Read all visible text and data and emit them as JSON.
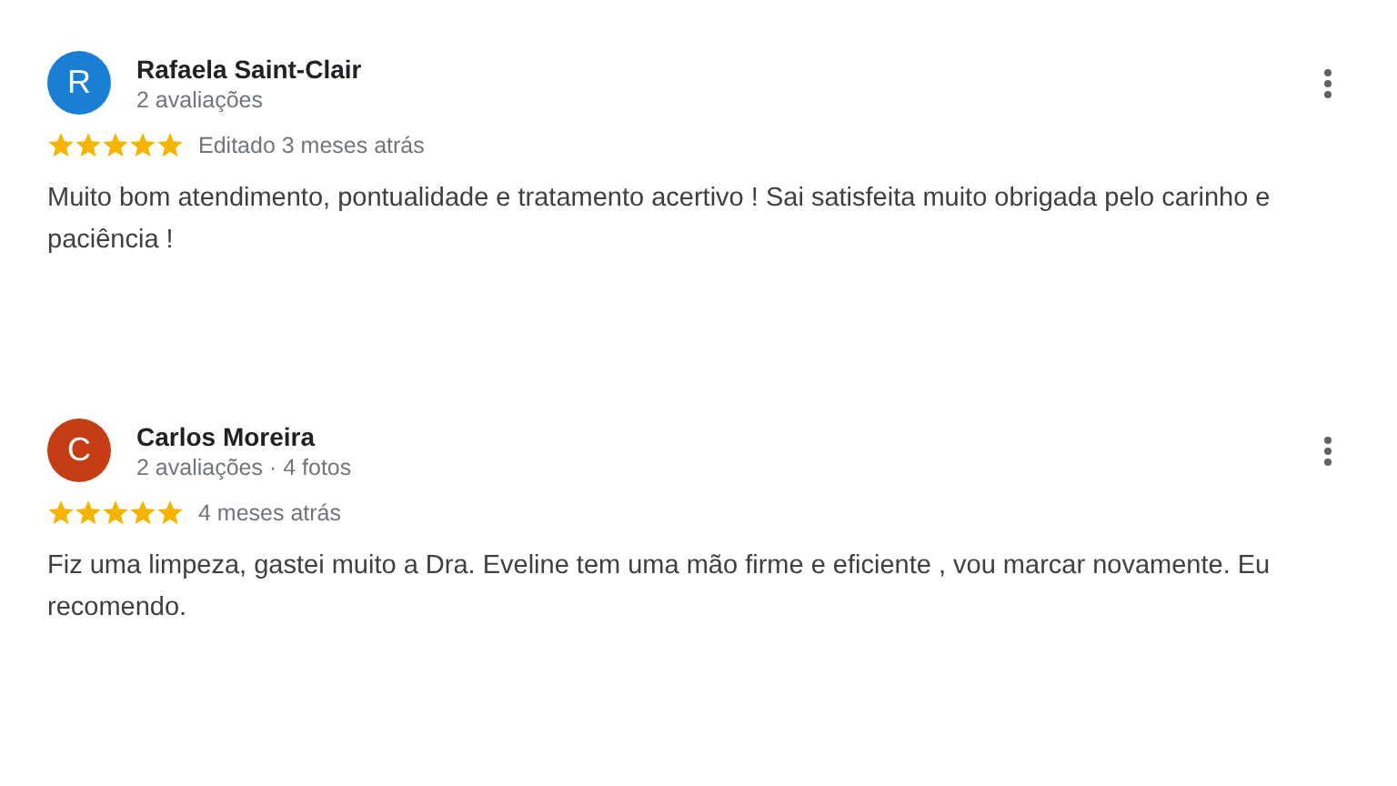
{
  "reviews": [
    {
      "avatar": "R",
      "color": "#1a7fd4",
      "name": "Rafaela Saint-Clair",
      "meta": "2 avaliações",
      "stars": 5,
      "time": "Editado 3 meses atrás",
      "text": "Muito bom atendimento, pontualidade e tratamento acertivo ! Sai satisfeita muito obrigada pelo carinho e paciência !"
    },
    {
      "avatar": "C",
      "color": "#c43d15",
      "name": "Carlos Moreira",
      "meta": "2 avaliações · 4 fotos",
      "stars": 5,
      "time": "4 meses atrás",
      "text": "Fiz uma limpeza, gastei muito a Dra. Eveline tem uma mão firme e eficiente , vou marcar novamente. Eu recomendo."
    }
  ]
}
